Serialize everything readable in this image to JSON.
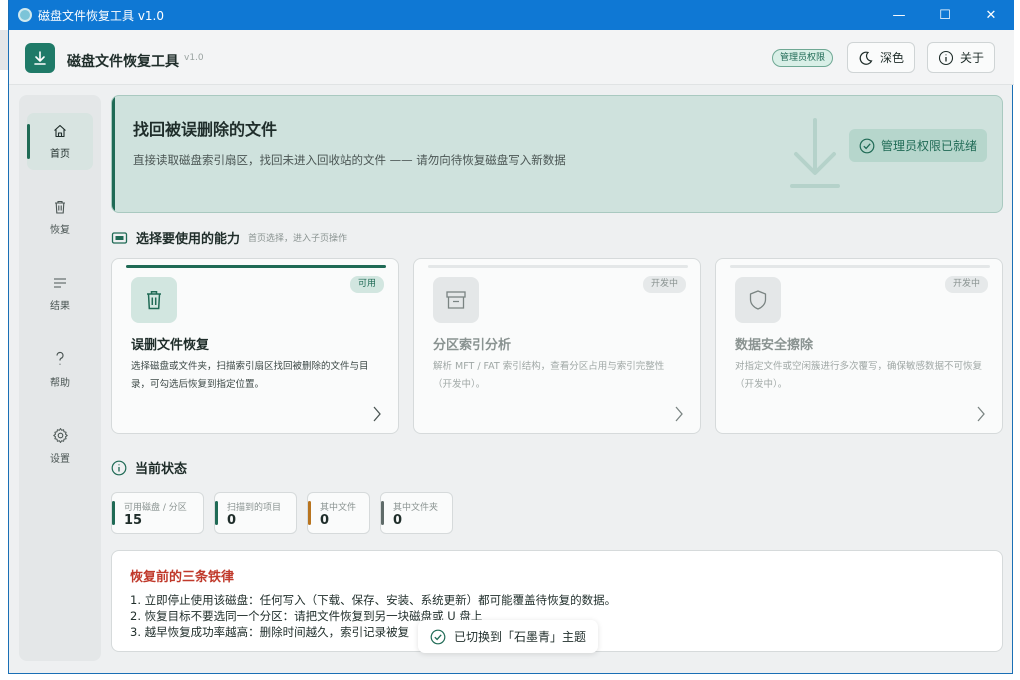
{
  "window": {
    "title": "磁盘文件恢复工具 v1.0",
    "min": "—",
    "max": "☐",
    "close": "✕"
  },
  "appbar": {
    "title": "磁盘文件恢复工具",
    "version": "v1.0",
    "admin_badge": "管理员权限",
    "theme_label": "深色",
    "about_label": "关于"
  },
  "sidebar": {
    "items": [
      {
        "label": "首页",
        "icon": "home-icon"
      },
      {
        "label": "恢复",
        "icon": "trash-icon"
      },
      {
        "label": "结果",
        "icon": "list-icon"
      },
      {
        "label": "帮助",
        "icon": "help-icon"
      },
      {
        "label": "设置",
        "icon": "gear-icon"
      }
    ]
  },
  "hero": {
    "title": "找回被误删除的文件",
    "subtitle": "直接读取磁盘索引扇区，找回未进入回收站的文件 —— 请勿向待恢复磁盘写入新数据",
    "status_chip": "管理员权限已就绪"
  },
  "capabilities": {
    "heading": "选择要使用的能力",
    "hint": "首页选择，进入子页操作",
    "cards": [
      {
        "title": "误删文件恢复",
        "tag": "可用",
        "desc": "选择磁盘或文件夹，扫描索引扇区找回被删除的文件与目录，可勾选后恢复到指定位置。"
      },
      {
        "title": "分区索引分析",
        "tag": "开发中",
        "desc": "解析 MFT / FAT 索引结构，查看分区占用与索引完整性（开发中）。"
      },
      {
        "title": "数据安全擦除",
        "tag": "开发中",
        "desc": "对指定文件或空闲簇进行多次覆写，确保敏感数据不可恢复（开发中）。"
      }
    ]
  },
  "status": {
    "heading": "当前状态",
    "stats": [
      {
        "label": "可用磁盘 / 分区",
        "value": "15",
        "color": "#1f6a55"
      },
      {
        "label": "扫描到的项目",
        "value": "0",
        "color": "#1f6a55"
      },
      {
        "label": "其中文件",
        "value": "0",
        "color": "#b8741f"
      },
      {
        "label": "其中文件夹",
        "value": "0",
        "color": "#5f6b69"
      }
    ]
  },
  "rules": {
    "title": "恢复前的三条铁律",
    "lines": [
      "1. 立即停止使用该磁盘：任何写入（下载、保存、安装、系统更新）都可能覆盖待恢复的数据。",
      "2. 恢复目标不要选同一个分区：请把文件恢复到另一块磁盘或 U 盘上",
      "3. 越早恢复成功率越高：删除时间越久，索引记录被复"
    ]
  },
  "toast": {
    "text": "已切换到「石墨青」主题"
  },
  "colors": {
    "accent": "#1f6a55",
    "titlebar": "#0f78d4",
    "warning": "#c0392b"
  }
}
